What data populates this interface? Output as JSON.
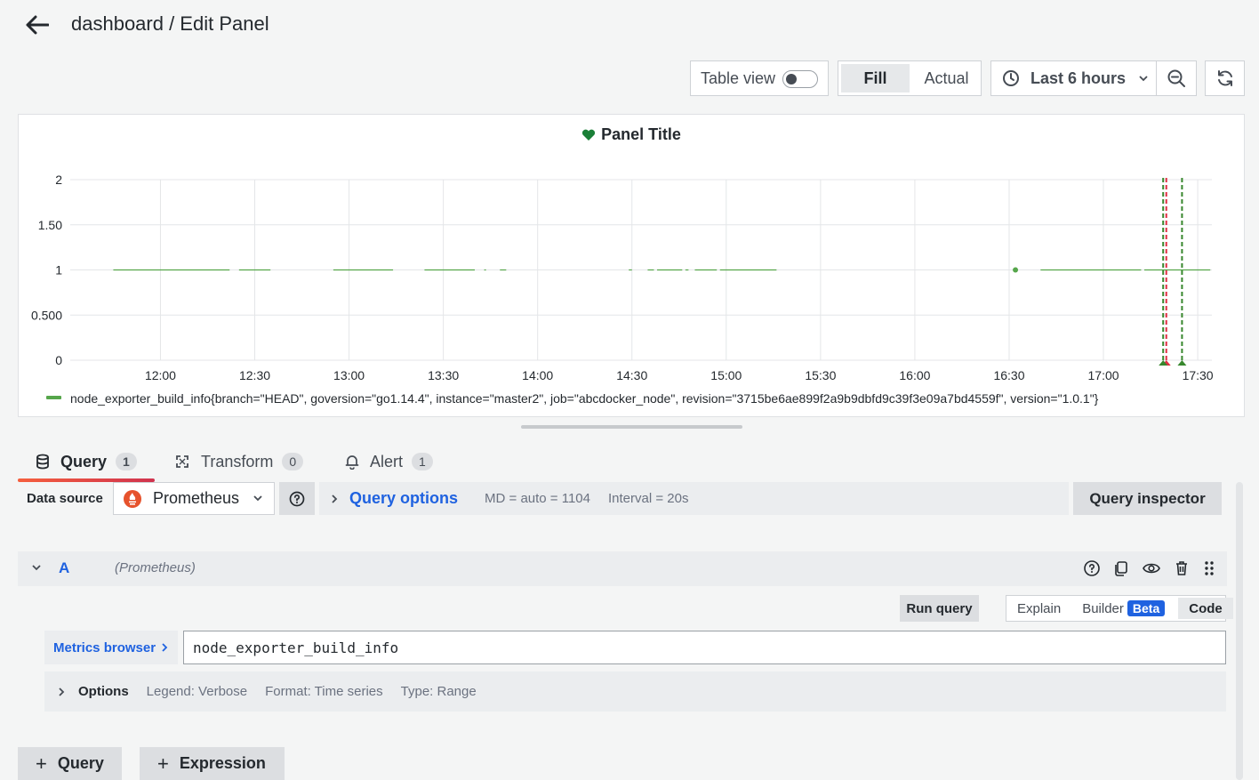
{
  "header": {
    "title": "dashboard / Edit Panel"
  },
  "toolbar": {
    "table_view_label": "Table view",
    "table_view_on": false,
    "fill_label": "Fill",
    "actual_label": "Actual",
    "time_range_label": "Last 6 hours"
  },
  "panel": {
    "title": "Panel Title",
    "legend": "node_exporter_build_info{branch=\"HEAD\", goversion=\"go1.14.4\", instance=\"master2\", job=\"abcdocker_node\", revision=\"3715be6ae899f2a9b9dbfd9c39f3e09a7bd4559f\", version=\"1.0.1\"}",
    "series_color": "#56a64b"
  },
  "chart_data": {
    "type": "line",
    "x_ticks": [
      "12:00",
      "12:30",
      "13:00",
      "13:30",
      "14:00",
      "14:30",
      "15:00",
      "15:30",
      "16:00",
      "16:30",
      "17:00",
      "17:30"
    ],
    "y_ticks": [
      "0",
      "0.500",
      "1",
      "1.50",
      "2"
    ],
    "ylim": [
      0,
      2
    ],
    "grid": true,
    "legend_position": "bottom-left",
    "series": [
      {
        "name": "node_exporter_build_info",
        "segments": [
          [
            "11:45",
            "12:22"
          ],
          [
            "12:25",
            "12:35"
          ],
          [
            "12:55",
            "13:14"
          ],
          [
            "13:24",
            "13:40"
          ],
          [
            "13:43",
            "13:43.5"
          ],
          [
            "13:48",
            "13:50"
          ],
          [
            "14:29",
            "14:30"
          ],
          [
            "14:35",
            "14:37"
          ],
          [
            "14:38",
            "14:46"
          ],
          [
            "14:47",
            "14:48"
          ],
          [
            "14:50",
            "14:57"
          ],
          [
            "14:58",
            "15:16"
          ],
          [
            "16:40",
            "17:12"
          ],
          [
            "17:13",
            "17:34"
          ]
        ],
        "points": [
          "16:32"
        ],
        "value": 1
      }
    ],
    "annotations": [
      {
        "time": "17:20",
        "color": "#e02f44"
      },
      {
        "time": "17:19",
        "color": "#37872d"
      },
      {
        "time": "17:25",
        "color": "#37872d"
      }
    ]
  },
  "tabs": [
    {
      "label": "Query",
      "count": "1"
    },
    {
      "label": "Transform",
      "count": "0"
    },
    {
      "label": "Alert",
      "count": "1"
    }
  ],
  "query_bar": {
    "data_source_label": "Data source",
    "data_source": "Prometheus",
    "query_options_label": "Query options",
    "md": "MD = auto = 1104",
    "interval": "Interval = 20s",
    "inspector_label": "Query inspector"
  },
  "query": {
    "ref": "A",
    "datasource": "(Prometheus)",
    "run_label": "Run query",
    "modes": {
      "explain": "Explain",
      "builder": "Builder",
      "beta": "Beta",
      "code": "Code"
    },
    "metrics_browser_label": "Metrics browser",
    "expression": "node_exporter_build_info",
    "options_label": "Options",
    "legend": "Legend: Verbose",
    "format": "Format: Time series",
    "type": "Type: Range"
  },
  "add": {
    "query_label": "Query",
    "expression_label": "Expression"
  }
}
